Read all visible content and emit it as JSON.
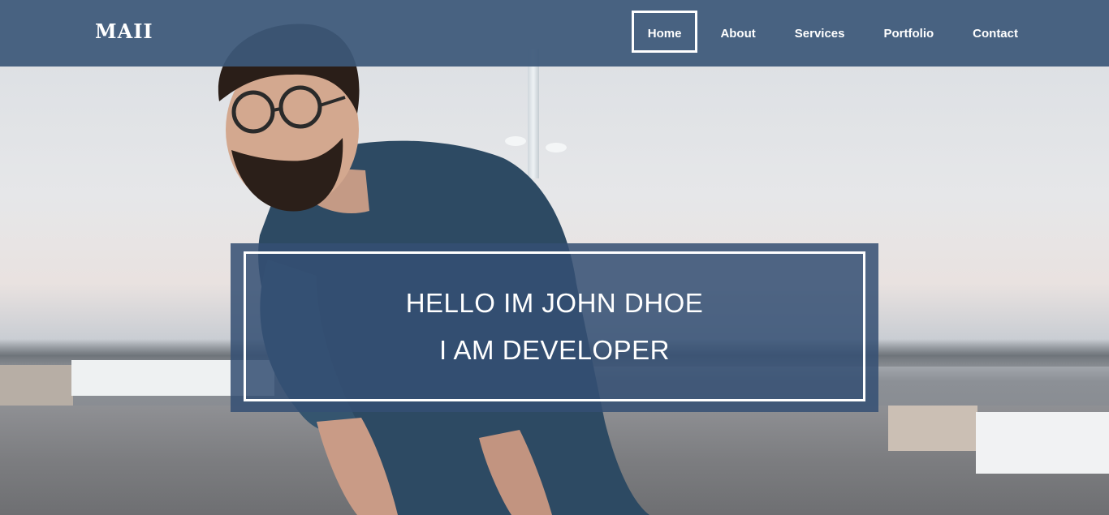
{
  "header": {
    "logo": "MAII",
    "nav": [
      {
        "label": "Home",
        "active": true
      },
      {
        "label": "About",
        "active": false
      },
      {
        "label": "Services",
        "active": false
      },
      {
        "label": "Portfolio",
        "active": false
      },
      {
        "label": "Contact",
        "active": false
      }
    ]
  },
  "hero": {
    "line1": "HELLO IM JOHN DHOE",
    "line2": "I AM DEVELOPER",
    "background_image": "man-with-glasses-and-beard-photo",
    "overlay_color": "#3c587a"
  }
}
